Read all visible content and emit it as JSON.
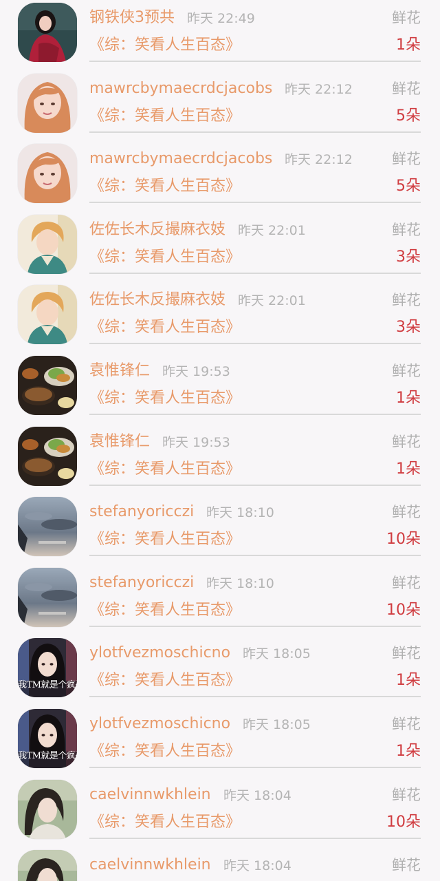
{
  "gift_list": {
    "items": [
      {
        "name": "钢铁侠3预共",
        "time": "昨天 22:49",
        "gift": "鲜花",
        "book": "《综：笑看人生百态》",
        "count": "1朵",
        "avatar": "girl-red-avatar"
      },
      {
        "name": "mawrcbymaecrdcjacobs",
        "time": "昨天 22:12",
        "gift": "鲜花",
        "book": "《综：笑看人生百态》",
        "count": "5朵",
        "avatar": "girl-orange-hair-avatar"
      },
      {
        "name": "mawrcbymaecrdcjacobs",
        "time": "昨天 22:12",
        "gift": "鲜花",
        "book": "《综：笑看人生百态》",
        "count": "5朵",
        "avatar": "girl-orange-hair-avatar"
      },
      {
        "name": "佐佐长木反撮麻衣妓",
        "time": "昨天 22:01",
        "gift": "鲜花",
        "book": "《综：笑看人生百态》",
        "count": "3朵",
        "avatar": "boy-blonde-avatar"
      },
      {
        "name": "佐佐长木反撮麻衣妓",
        "time": "昨天 22:01",
        "gift": "鲜花",
        "book": "《综：笑看人生百态》",
        "count": "3朵",
        "avatar": "boy-blonde-avatar"
      },
      {
        "name": "袁惟锋仁",
        "time": "昨天 19:53",
        "gift": "鲜花",
        "book": "《综：笑看人生百态》",
        "count": "1朵",
        "avatar": "food-avatar"
      },
      {
        "name": "袁惟锋仁",
        "time": "昨天 19:53",
        "gift": "鲜花",
        "book": "《综：笑看人生百态》",
        "count": "1朵",
        "avatar": "food-avatar"
      },
      {
        "name": "stefanyoricczi",
        "time": "昨天 18:10",
        "gift": "鲜花",
        "book": "《综：笑看人生百态》",
        "count": "10朵",
        "avatar": "sky-avatar"
      },
      {
        "name": "stefanyoricczi",
        "time": "昨天 18:10",
        "gift": "鲜花",
        "book": "《综：笑看人生百态》",
        "count": "10朵",
        "avatar": "sky-avatar"
      },
      {
        "name": "ylotfvezmoschicno",
        "time": "昨天 18:05",
        "gift": "鲜花",
        "book": "《综：笑看人生百态》",
        "count": "1朵",
        "avatar": "girl-dark-hair-avatar",
        "avatar_caption": "我TM就是个疯子"
      },
      {
        "name": "ylotfvezmoschicno",
        "time": "昨天 18:05",
        "gift": "鲜花",
        "book": "《综：笑看人生百态》",
        "count": "1朵",
        "avatar": "girl-dark-hair-avatar",
        "avatar_caption": "我TM就是个疯子"
      },
      {
        "name": "caelvinnwkhlein",
        "time": "昨天 18:04",
        "gift": "鲜花",
        "book": "《综：笑看人生百态》",
        "count": "10朵",
        "avatar": "girl-green-avatar"
      },
      {
        "name": "caelvinnwkhlein",
        "time": "昨天 18:04",
        "gift": "鲜花",
        "book": "",
        "count": "",
        "avatar": "girl-green-avatar"
      }
    ]
  },
  "colors": {
    "background": "#f8f6f8",
    "name_text": "#e89a6a",
    "time_text": "#b4b4b4",
    "gift_text": "#b0b0b0",
    "count_text": "#d03c40",
    "divider": "#d9d9d9"
  }
}
